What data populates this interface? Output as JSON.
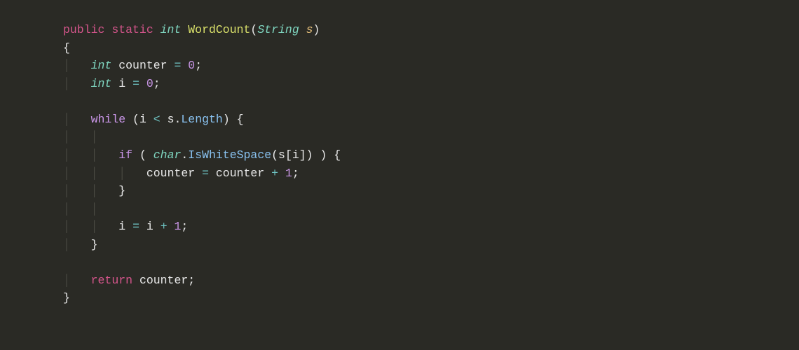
{
  "code": {
    "t_public": "public",
    "t_static": "static",
    "t_int": "int",
    "t_fn": "WordCount",
    "t_lparen": "(",
    "t_String": "String",
    "t_param_s": "s",
    "t_rparen": ")",
    "t_lbrace": "{",
    "t_rbrace": "}",
    "t_counter": "counter",
    "t_eq": "=",
    "t_zero": "0",
    "t_semi": ";",
    "t_i": "i",
    "t_while": "while",
    "t_lt": "<",
    "t_dot": ".",
    "t_Length": "Length",
    "t_if": "if",
    "t_char": "char",
    "t_IsWhiteSpace": "IsWhiteSpace",
    "t_lbracket": "[",
    "t_rbracket": "]",
    "t_plus": "+",
    "t_one": "1",
    "t_return": "return",
    "guide": "│"
  }
}
